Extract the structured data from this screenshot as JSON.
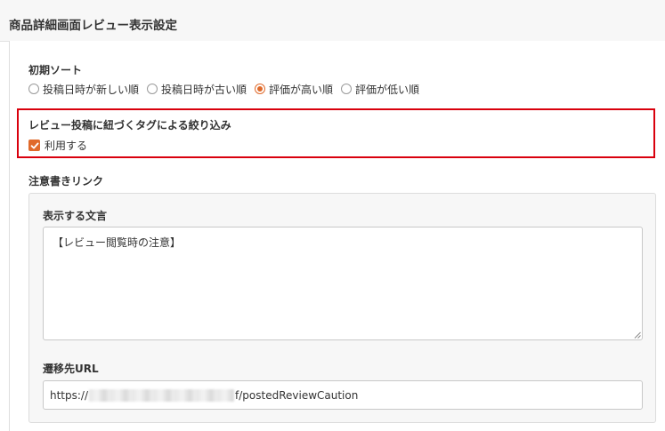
{
  "header": {
    "title": "商品詳細画面レビュー表示設定"
  },
  "sort": {
    "label": "初期ソート",
    "options": [
      {
        "label": "投稿日時が新しい順",
        "checked": false
      },
      {
        "label": "投稿日時が古い順",
        "checked": false
      },
      {
        "label": "評価が高い順",
        "checked": true
      },
      {
        "label": "評価が低い順",
        "checked": false
      }
    ]
  },
  "tag_filter": {
    "label": "レビュー投稿に紐づくタグによる絞り込み",
    "checkbox_label": "利用する",
    "checked": true
  },
  "caution_link": {
    "label": "注意書きリンク",
    "text_label": "表示する文言",
    "text_value": "【レビュー閲覧時の注意】",
    "url_label": "遷移先URL",
    "url_prefix": "https://",
    "url_suffix": "f/postedReviewCaution"
  },
  "colors": {
    "accent": "#e06a2b",
    "highlight": "#d9000d"
  }
}
